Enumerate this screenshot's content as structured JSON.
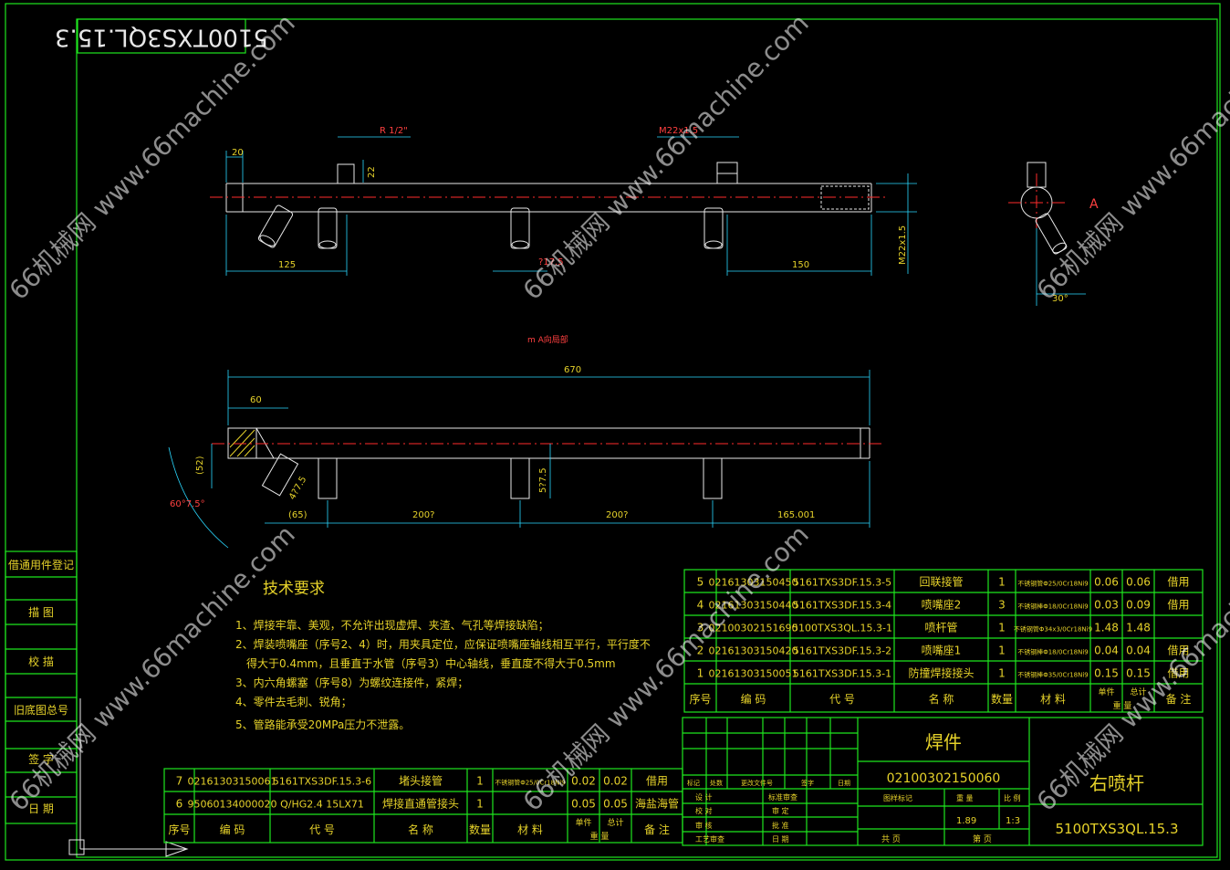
{
  "drawing_code_rotated": "5100TXS3QL.15.3",
  "view_label_A": "A",
  "view_caption": "m A向局部",
  "dims": {
    "d20": "20",
    "d22": "22",
    "d125": "125",
    "d150": "150",
    "r_half": "R 1/2\"",
    "m22_top": "M22x1.5",
    "m22_side": "M22x1.5",
    "d670": "670",
    "d60": "60",
    "d52": "(52)",
    "angle": "60°7.5°",
    "d65": "(65)",
    "d200a": "200?",
    "d200b": "200?",
    "d165": "165.001",
    "d375": "5?7.5",
    "d47": "4?7.5",
    "d30": "30°",
    "d175": "?17.5"
  },
  "notes": {
    "title": "技术要求",
    "items": [
      "1、焊接牢靠、美观，不允许出现虚焊、夹渣、气孔等焊接缺陷；",
      "2、焊装喷嘴座（序号2、4）时，用夹具定位，应保证喷嘴座轴线相互平行，平行度不",
      "得大于0.4mm，且垂直于水管（序号3）中心轴线，垂直度不得大于0.5mm",
      "3、内六角螺塞（序号8）为螺纹连接件，紧焊；",
      "4、零件去毛刺、锐角；",
      "5、管路能承受20MPa压力不泄露。"
    ]
  },
  "left_strip": [
    "借通用件登记",
    "描 图",
    "校 描",
    "旧底图总号",
    "签 字",
    "日 期"
  ],
  "bom_right": {
    "rows": [
      [
        "5",
        "02161303150450",
        "5161TXS3DF.15.3-5",
        "回联接管",
        "1",
        "不锈钢管Φ25/0Cr18Ni9",
        "0.06",
        "0.06",
        "借用"
      ],
      [
        "4",
        "02161303150440",
        "5161TXS3DF.15.3-4",
        "喷嘴座2",
        "3",
        "不锈钢棒Φ18/0Cr18Ni9",
        "0.03",
        "0.09",
        "借用"
      ],
      [
        "3",
        "02100302151690",
        "5100TXS3QL.15.3-1",
        "喷杆管",
        "1",
        "不锈钢管Φ34x3/0Cr18Ni9",
        "1.48",
        "1.48",
        ""
      ],
      [
        "2",
        "02161303150420",
        "5161TXS3DF.15.3-2",
        "喷嘴座1",
        "1",
        "不锈钢棒Φ18/0Cr18Ni9",
        "0.04",
        "0.04",
        "借用"
      ],
      [
        "1",
        "02161303150051",
        "5161TXS3DF.15.3-1",
        "防撞焊接接头",
        "1",
        "不锈钢棒Φ35/0Cr18Ni9",
        "0.15",
        "0.15",
        "借用"
      ]
    ],
    "header": [
      "序号",
      "编 码",
      "代 号",
      "名 称",
      "数量",
      "材 料",
      "单件",
      "总计",
      "备 注"
    ],
    "header_sub": "重 量"
  },
  "bom_left": {
    "rows": [
      [
        "7",
        "02161303150061",
        "5161TXS3DF.15.3-6",
        "堵头接管",
        "1",
        "不锈钢管Φ25/0Cr18Ni9",
        "0.02",
        "0.02",
        "借用"
      ],
      [
        "6",
        "95060134000020",
        "Q/HG2.4 15LX71",
        "焊接直通管接头",
        "1",
        "",
        "0.05",
        "0.05",
        "海盐海管"
      ]
    ],
    "header": [
      "序号",
      "编 码",
      "代 号",
      "名 称",
      "数量",
      "材 料",
      "单件",
      "总计",
      "备 注"
    ],
    "header_sub": "重 量"
  },
  "title_block": {
    "part_type": "焊件",
    "code": "02100302150060",
    "name": "右喷杆",
    "drawing_no": "5100TXS3QL.15.3",
    "stage_label": "图样标记",
    "weight_label": "重 量",
    "scale_label": "比 例",
    "weight": "1.89",
    "scale": "1:3",
    "sheets": "共 页",
    "sheet": "第 页",
    "sign_headers": [
      "标记",
      "处数",
      "更改文件号",
      "签字",
      "日期"
    ],
    "roles": [
      "设 计",
      "校 对",
      "审 核",
      "工艺审查"
    ],
    "roles2": [
      "标准审查",
      "审 定",
      "批 准",
      "日 期"
    ]
  },
  "watermark": "66机械网 www.66machine.com"
}
